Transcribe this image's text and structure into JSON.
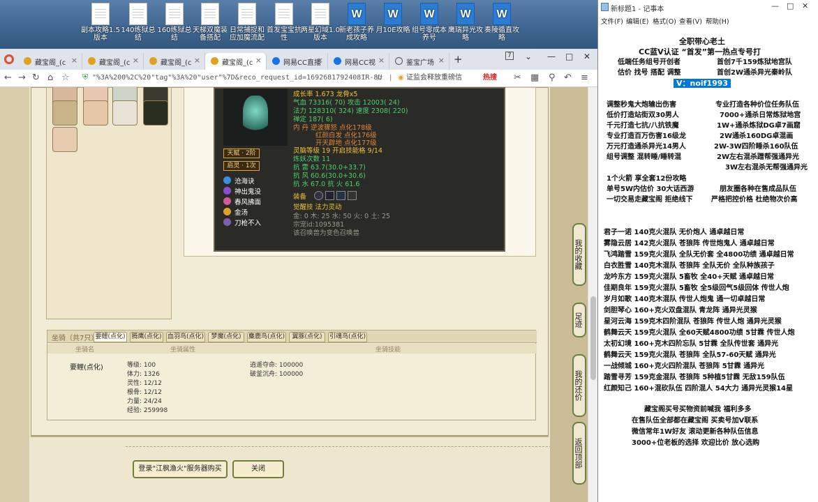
{
  "desktop_icons": [
    {
      "label": "副本攻略1.5版本",
      "type": "doc"
    },
    {
      "label": "140练狱总结",
      "type": "doc"
    },
    {
      "label": "160练狱总结",
      "type": "doc"
    },
    {
      "label": "天梯双魔装备搭配",
      "type": "doc"
    },
    {
      "label": "日常捕捉和应加魔流配",
      "type": "doc"
    },
    {
      "label": "首发宝宝抗性",
      "type": "doc"
    },
    {
      "label": "两星幻域1.0版本",
      "type": "doc"
    },
    {
      "label": "新老孩子养成攻略",
      "type": "word"
    },
    {
      "label": "月10E攻略",
      "type": "word"
    },
    {
      "label": "组号零成本养号",
      "type": "word"
    },
    {
      "label": "鹰瑞异光攻略",
      "type": "word"
    },
    {
      "label": "奏陵循直攻略",
      "type": "word"
    }
  ],
  "browser": {
    "tabs": [
      {
        "label": "藏宝阁_(c",
        "icon": "treasure-icon"
      },
      {
        "label": "藏宝阁_(c",
        "icon": "treasure-icon"
      },
      {
        "label": "藏宝阁_(c",
        "icon": "treasure-icon"
      },
      {
        "label": "藏宝阁_(c",
        "icon": "treasure-icon",
        "active": true
      },
      {
        "label": "网易CC直播",
        "icon": "cc-icon"
      },
      {
        "label": "网易CC视",
        "icon": "cc-icon"
      },
      {
        "label": "鉴宝广场",
        "icon": "globe-icon"
      }
    ],
    "tab_count": "7",
    "url": "\"%3A%200%2C%20\"tag\"%3A%20\"user\"%7D&reco_request_id=1692681792408IR-8U",
    "search_placeholder": "证监会释放重磅信",
    "hot_label": "热搜"
  },
  "pet": {
    "growth": "成长率 1.673 龙骨x5",
    "hp": "气血 73316( 70) 攻击 12003( 24)",
    "mp": "法力 128310( 324) 速度 2308( 220)",
    "zen": "禅定 187( 6)",
    "dan": "内  丹  逆波骤怒 点化178级",
    "dan2": "红颜白发 点化176级",
    "dan3": "开天辟地 点化177级",
    "spirit_level": "灵脑等级   19  开启技能格   9/14",
    "refine": "炼妖次数 11",
    "resist1": "抗   雷  63.7(30.0+33.7)",
    "resist2": "抗   风  60.6(30.0+30.6)",
    "resist3": "抗   水 67.0  抗   火 61.6",
    "badge1": "天赋 · 2阶",
    "badge2": "启灵 · 1次",
    "skills": [
      {
        "name": "沧海诀",
        "color": "#3a8fe0"
      },
      {
        "name": "神出鬼没",
        "color": "#8a4fd0"
      },
      {
        "name": "春风拂面",
        "color": "#d05a9a"
      },
      {
        "name": "金汤",
        "color": "#e0a030"
      },
      {
        "name": "刀枪不入",
        "color": "#7a60b0"
      }
    ],
    "equip_label": "装备",
    "awaken": "觉醒技       法力灵动",
    "elements": "金: 0 木: 25  水: 50  火: 0  土: 25",
    "pet_id": "宗宠id:1095381",
    "note": "该召唤兽为变色召唤兽"
  },
  "mount": {
    "title": "坐骑（共7只）",
    "tabs": [
      "要鲤(点化)",
      "腾鹰(点化)",
      "血羽鸟(点化)",
      "梦魔(点化)",
      "麋鹿鸟(点化)",
      "翼豚(点化)",
      "引魂鸟(点化)"
    ],
    "col_name": "坐骑名",
    "col_attr": "坐骑属性",
    "col_skill": "坐骑技能",
    "name": "要鲤(点化)",
    "stats": [
      "等级: 100",
      "体力: 1326",
      "灵性: 12/12",
      "根骨: 12/12",
      "力量: 24/24",
      "经验: 259998"
    ],
    "skills": [
      "逍遥夺命: 100000",
      "破釜沉舟: 100000"
    ]
  },
  "buttons": {
    "login": "登录\"江枫渔火\"服务器购买",
    "close": "关闭"
  },
  "side_buttons": [
    "我的收藏",
    "足迹",
    "我的还价",
    "返回顶部"
  ],
  "notepad": {
    "title": "新标题1 - 记事本",
    "menu": [
      "文件(F)",
      "编辑(E)",
      "格式(O)",
      "查看(V)",
      "帮助(H)"
    ],
    "lines": [
      "全职带心老土",
      "CC蓝V认证 “首发”第一热点专号打",
      "低端任务组号开创者",
      "首创7千159炼狱地宫队",
      "估价 找号 搭配 调整",
      "首创2W通杀异光秦岭队",
      "V：noif1993",
      "调整秒鬼大炮输出伤害",
      "专业打造各种价位任务队伍",
      "低价打造站街双30男人",
      "7000+通杀日常炼狱地宫",
      "千元打造七抗/八抗铁魔",
      "1W+通杀炼狱DG卓7画窟",
      "专业打造百万伤害16级龙",
      "2W通杀160DG卓混画",
      "万元打造通杀异光14男人",
      "2W-3W四阶睡杀160队伍",
      "组号调整 混转睡/睡转混",
      "2W左右混杀蹭帮强通异光",
      "3W左右混杀无帮强通异光",
      "1个火箭 享全套12份攻略",
      "单号5W内估价 30大话西游",
      "朋友圈各种在售成品队伍",
      "一切交易走藏宝阁 拒绝线下",
      "严格把控价格 杜绝物次价高",
      "君子一诺 140克火混队 无价炮人 通卓越日常",
      "雾隐云居 142克火混队 苍狼阵 传世炮鬼人 通卓越日常",
      "飞鸿踏雪 159克火混队 全队无价套 全4800功绩 通卓越日常",
      "白衣胜雪 140克木混队 苍狼阵 全队无价 全队种族孩子",
      "龙吟东方 159克火混队 5畜牧 全40+天赋 通卓越日常",
      "佳期良年 159克火混队 5畜牧 全5级回气5级回体 传世人炮",
      "岁月如歌 140克木混队 传世人炮鬼 通一切卓越日常",
      "剑胆琴心 160+克火双盘混队 青龙阵 通异光灵猴",
      "星河云海 159克木四阶混队 苍狼阵 传世人炮 通异光灵猴",
      "鹤舞云天 159克火混队 全60天赋4800功绩 5甘霖 传世人炮",
      "太初幻境 160+克木四阶忘队 5甘霖 全队传世套 通异光",
      "鹤舞云天 159克火混队 苍狼阵 全队57-60天赋 通异光",
      "一战倾城 160+克火四阶混队 苍狼阵 5甘霖 通异光",
      "踏雪寻芳 159克金混队 苍狼阵 5种植5甘霖 无敌159队伍",
      "红颜知己 160+混砍队伍 四阶混人 54大力 通异光灵猴14星",
      "藏宝阁买号买物资前喊我 福利多多",
      "在售队伍全部都在藏宝阁 买卖号加V联系",
      "微信常年1W好友 滚动更新各种队伍信息",
      "3000+位老板的选择 欢迎比价 放心选购"
    ]
  }
}
